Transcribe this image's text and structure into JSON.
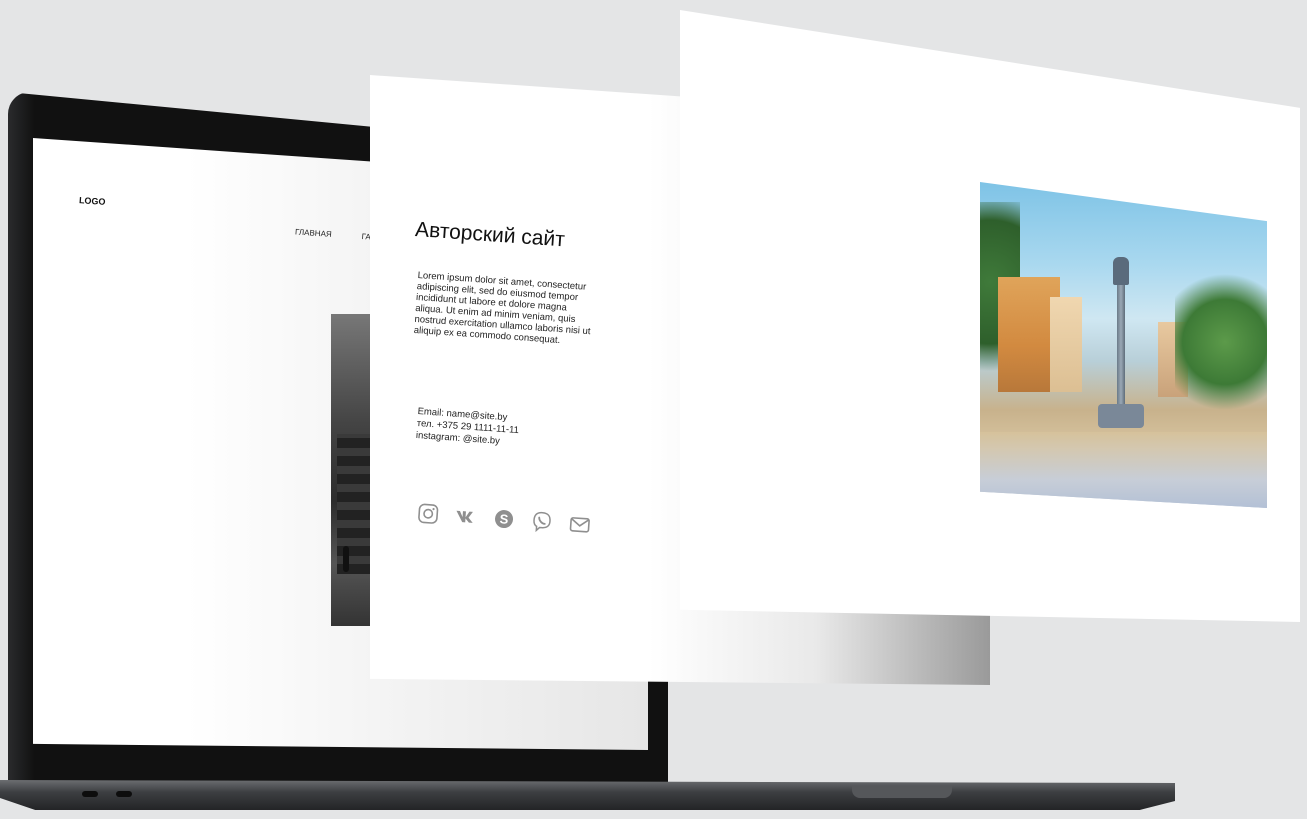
{
  "laptop_site": {
    "logo": "LOGO",
    "nav": [
      "ГЛАВНАЯ",
      "ГА"
    ]
  },
  "author_card": {
    "title": "Авторский сайт",
    "body": "Lorem ipsum dolor sit amet, consectetur adipiscing elit, sed do eiusmod tempor incididunt ut labore et dolore magna aliqua. Ut enim ad minim veniam, quis nostrud exercitation ullamco laboris nisi ut aliquip ex ea commodo consequat.",
    "contacts": {
      "email": "Email: name@site.by",
      "phone": "тел. +375 29 1111-11-11",
      "instagram": "instagram: @site.by"
    },
    "social_icons": [
      "instagram-icon",
      "vk-icon",
      "skype-icon",
      "viber-icon",
      "mail-icon"
    ],
    "icon_color": "#8f8f8f"
  },
  "gallery_card": {
    "image": "watercolor-city-square-painting"
  },
  "colors": {
    "background": "#e4e5e6",
    "laptop_body": "#111111"
  }
}
